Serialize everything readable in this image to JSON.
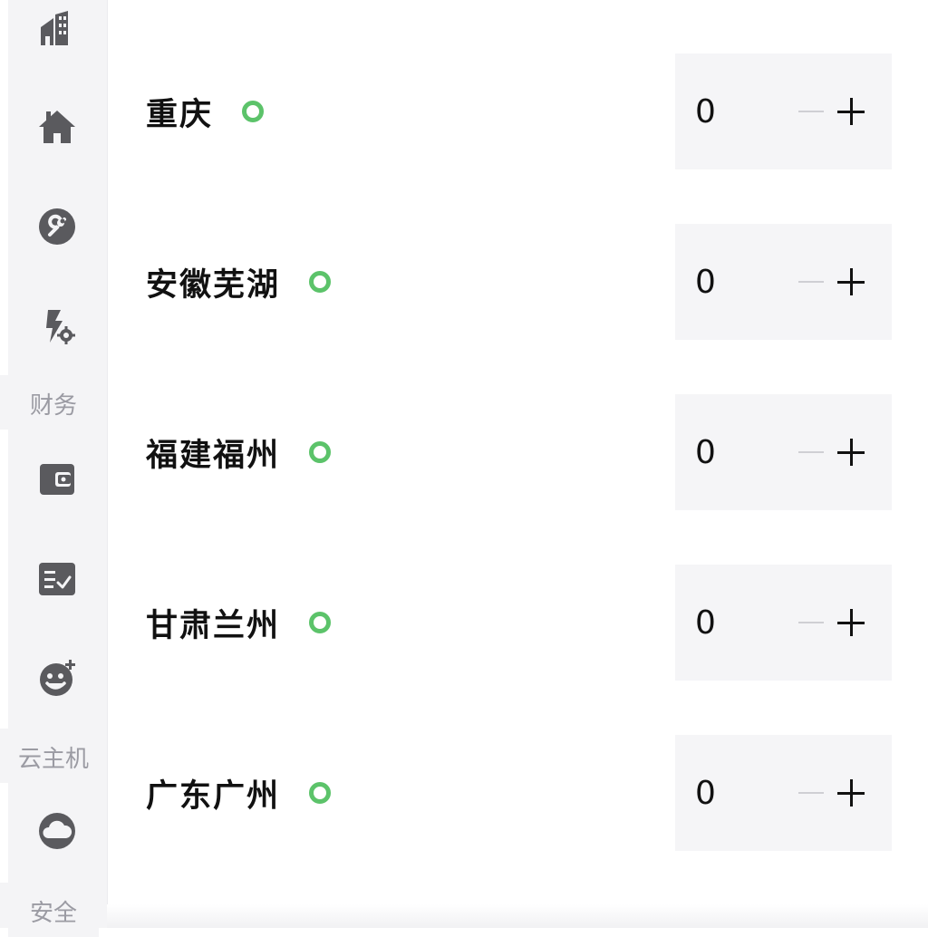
{
  "sidebar": {
    "icons": [
      {
        "name": "building-icon"
      },
      {
        "name": "home-icon"
      },
      {
        "name": "wrench-icon"
      },
      {
        "name": "lightning-gear-icon"
      },
      {
        "name": "wallet-icon"
      },
      {
        "name": "checklist-icon"
      },
      {
        "name": "smiley-add-icon"
      },
      {
        "name": "cloud-icon"
      }
    ],
    "labels": {
      "finance": "财务",
      "cloud_host": "云主机",
      "security": "安全"
    }
  },
  "regions": [
    {
      "name": "重庆",
      "value": "0",
      "status": "online"
    },
    {
      "name": "安徽芜湖",
      "value": "0",
      "status": "online"
    },
    {
      "name": "福建福州",
      "value": "0",
      "status": "online"
    },
    {
      "name": "甘肃兰州",
      "value": "0",
      "status": "online"
    },
    {
      "name": "广东广州",
      "value": "0",
      "status": "online"
    }
  ],
  "colors": {
    "status_online": "#5cc36a",
    "icon": "#5a5a5e",
    "sidebar_label": "#9b9ba3"
  }
}
